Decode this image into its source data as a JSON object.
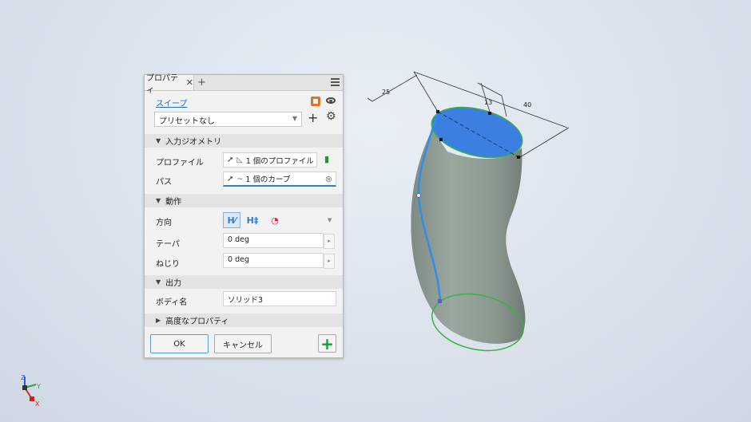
{
  "tab": {
    "label": "プロパティ",
    "close": "✕",
    "add": "+"
  },
  "command": {
    "title": "スイープ"
  },
  "preset": {
    "value": "プリセットなし"
  },
  "sections": {
    "input_geometry": "入力ジオメトリ",
    "behavior": "動作",
    "output": "出力",
    "advanced": "高度なプロパティ"
  },
  "fields": {
    "profile_label": "プロファイル",
    "profile_value": "1 個のプロファイル",
    "path_label": "パス",
    "path_value": "1 個のカーブ",
    "direction_label": "方向",
    "taper_label": "テーパ",
    "taper_value": "0 deg",
    "twist_label": "ねじり",
    "twist_value": "0 deg",
    "body_name_label": "ボディ名",
    "body_name_value": "ソリッド3"
  },
  "buttons": {
    "ok": "OK",
    "cancel": "キャンセル"
  },
  "dimensions": {
    "d1": "25",
    "d2": "13",
    "d3": "40"
  },
  "viewcube_axes": {
    "x": "X",
    "y": "Y",
    "z": "Z"
  },
  "colors": {
    "accent": "#2d7fd1",
    "profile_fill": "#3b7fe0",
    "body": "#8c9a92",
    "edge_green": "#3cb043",
    "path_blue": "#2f8fe8"
  }
}
